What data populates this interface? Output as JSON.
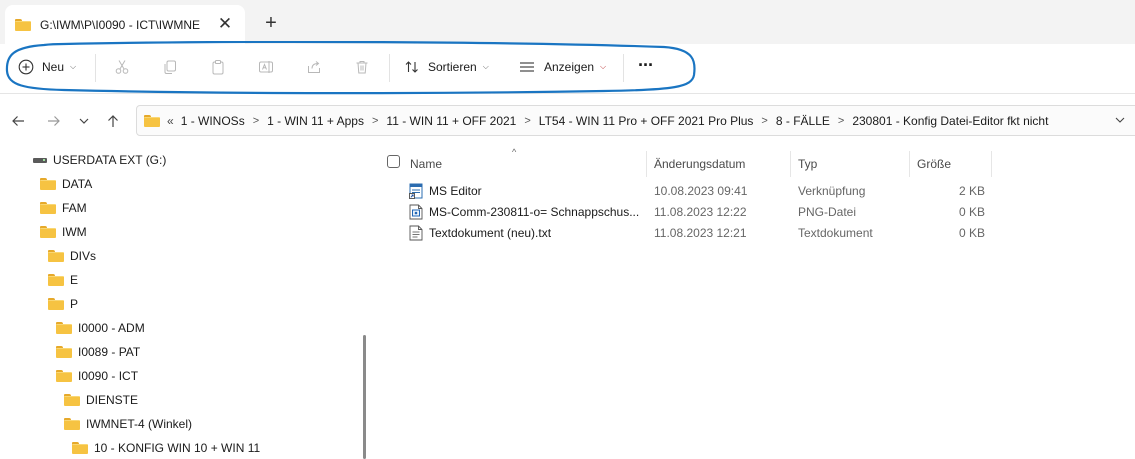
{
  "tab": {
    "title": "G:\\IWM\\P\\I0090 - ICT\\IWMNE",
    "close_glyph": "✕",
    "new_glyph": "+"
  },
  "toolbar": {
    "new_label": "Neu",
    "sort_label": "Sortieren",
    "view_label": "Anzeigen",
    "more_glyph": "···",
    "annotation_color": "#1a75c2"
  },
  "address": {
    "lead": "«",
    "crumbs": [
      "1 - WINOSs",
      "1 - WIN 11 + Apps",
      "11 - WIN 11 + OFF 2021",
      "LT54 - WIN 11 Pro + OFF 2021 Pro Plus",
      "8 - FÄLLE",
      "230801 - Konfig Datei-Editor fkt nicht"
    ],
    "separator": ">"
  },
  "tree": [
    {
      "label": "USERDATA EXT (G:)",
      "icon": "drive-icon"
    },
    {
      "label": "DATA",
      "icon": "folder-icon"
    },
    {
      "label": "FAM",
      "icon": "folder-icon"
    },
    {
      "label": "IWM",
      "icon": "folder-icon"
    },
    {
      "label": "DIVs",
      "icon": "folder-icon"
    },
    {
      "label": "E",
      "icon": "folder-icon"
    },
    {
      "label": "P",
      "icon": "folder-icon"
    },
    {
      "label": "I0000 - ADM",
      "icon": "folder-icon"
    },
    {
      "label": "I0089 - PAT",
      "icon": "folder-icon"
    },
    {
      "label": "I0090 - ICT",
      "icon": "folder-icon"
    },
    {
      "label": "DIENSTE",
      "icon": "folder-icon"
    },
    {
      "label": "IWMNET-4 (Winkel)",
      "icon": "folder-icon"
    },
    {
      "label": "10 - KONFIG WIN 10 + WIN 11",
      "icon": "folder-icon"
    }
  ],
  "columns": {
    "name": "Name",
    "date": "Änderungsdatum",
    "type": "Typ",
    "size": "Größe",
    "sort_glyph": "^"
  },
  "files": [
    {
      "name": "MS Editor",
      "date": "10.08.2023 09:41",
      "type": "Verknüpfung",
      "size": "2 KB",
      "icon": "shortcut-icon"
    },
    {
      "name": "MS-Comm-230811-o= Schnappschus...",
      "date": "11.08.2023 12:22",
      "type": "PNG-Datei",
      "size": "0 KB",
      "icon": "image-file-icon"
    },
    {
      "name": "Textdokument (neu).txt",
      "date": "11.08.2023 12:21",
      "type": "Textdokument",
      "size": "0 KB",
      "icon": "text-file-icon"
    }
  ]
}
